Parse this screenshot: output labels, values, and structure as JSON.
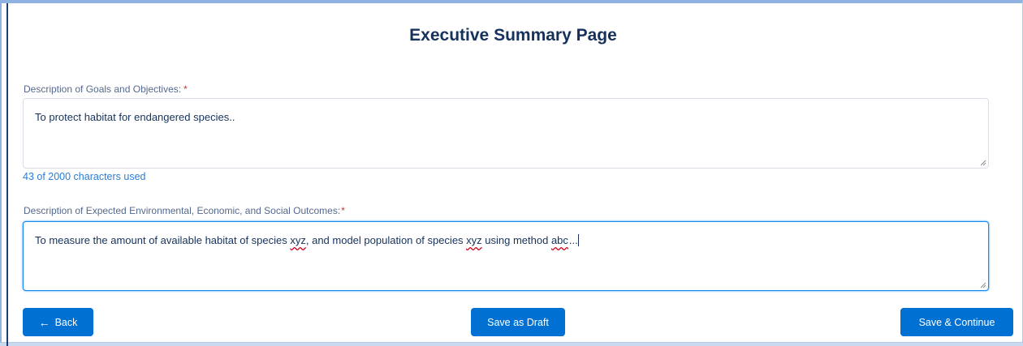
{
  "page": {
    "title": "Executive Summary Page"
  },
  "goals": {
    "label": "Description of Goals and Objectives:",
    "required_mark": "*",
    "value": "To protect habitat for endangered species..",
    "counter": "43 of 2000 characters used"
  },
  "outcomes": {
    "label": "Description of Expected Environmental, Economic, and Social Outcomes:",
    "required_mark": "*",
    "value_parts": {
      "p1": "To measure the amount of available habitat of species ",
      "w1": "xyz",
      "p2": ", and model population of species ",
      "w2": "xyz",
      "p3": " using method ",
      "w3": "abc",
      "p4": "..."
    }
  },
  "buttons": {
    "back": "Back",
    "back_icon": "←",
    "draft": "Save as Draft",
    "continue": "Save & Continue"
  },
  "colors": {
    "primary": "#0070d2",
    "title": "#16325c",
    "required": "#c23934",
    "counter": "#2a7dd3",
    "focus": "#1589ee"
  }
}
